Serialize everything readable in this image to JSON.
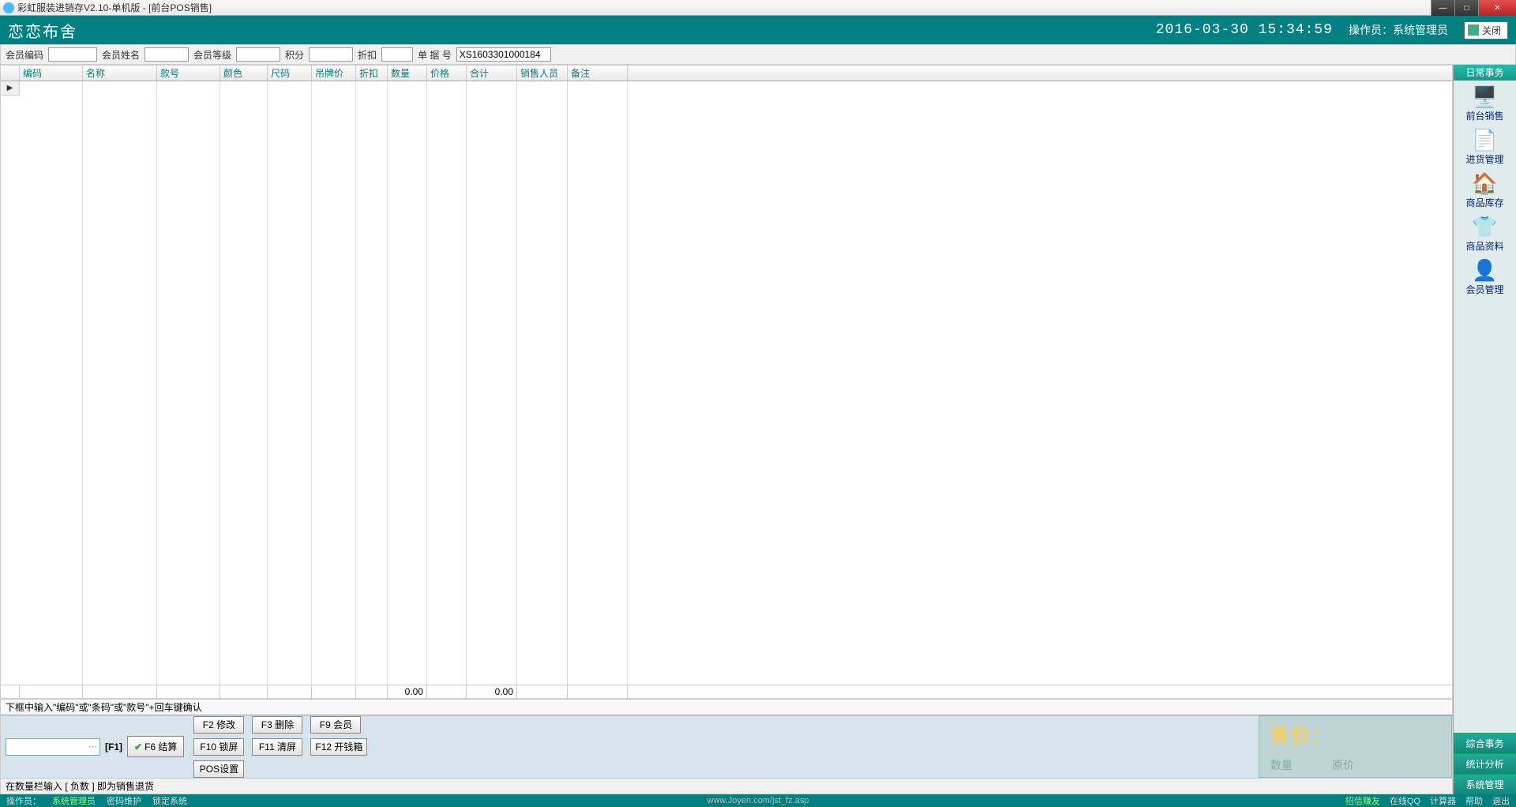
{
  "window": {
    "title": "彩虹服装进销存V2.10-单机版 - [前台POS销售]"
  },
  "header": {
    "store_name": "恋恋布舍",
    "datetime": "2016-03-30 15:34:59",
    "operator_label": "操作员：系统管理员",
    "close_label": "关闭"
  },
  "filters": {
    "member_code_label": "会员编码",
    "member_name_label": "会员姓名",
    "member_level_label": "会员等级",
    "points_label": "积分",
    "discount_label": "折扣",
    "order_no_label": "单 据 号",
    "order_no_value": "XS1603301000184"
  },
  "grid_headers": [
    "编码",
    "名称",
    "款号",
    "颜色",
    "尺码",
    "吊牌价",
    "折扣",
    "数量",
    "价格",
    "合计",
    "销售人员",
    "备注"
  ],
  "totals": {
    "qty": "0.00",
    "amount": "0.00"
  },
  "hints": {
    "input_hint": "下框中输入\"编码\"或\"条码\"或\"款号\"+回车键确认",
    "neg_hint": "在数量栏输入 [ 负数 ] 即为销售退货"
  },
  "fkeys": {
    "f1": "[F1]",
    "f6": "F6 结算",
    "row1": [
      "F2 修改",
      "F3 删除",
      "F9 会员"
    ],
    "row2": [
      "F10 锁屏",
      "F11 清屏",
      "F12 开钱箱"
    ],
    "pos": "POS设置"
  },
  "price_panel": {
    "price_label": "售价：",
    "qty_label": "数量",
    "orig_label": "原价"
  },
  "sidebar": {
    "tab": "日常事务",
    "items": [
      {
        "icon": "🖥️",
        "label": "前台销售"
      },
      {
        "icon": "📄",
        "label": "进货管理"
      },
      {
        "icon": "🏠",
        "label": "商品库存"
      },
      {
        "icon": "👕",
        "label": "商品资料"
      },
      {
        "icon": "👤",
        "label": "会员管理"
      }
    ],
    "bottom": [
      "综合事务",
      "统计分析",
      "系统管理"
    ]
  },
  "statusbar": {
    "op_label": "操作员：",
    "op_value": "系统管理员",
    "pwd": "密码维护",
    "lock": "锁定系统",
    "url": "www.Joyen.com/jst_fz.asp",
    "links": [
      "招信赚友",
      "在线QQ",
      "计算器",
      "帮助",
      "退出"
    ]
  }
}
